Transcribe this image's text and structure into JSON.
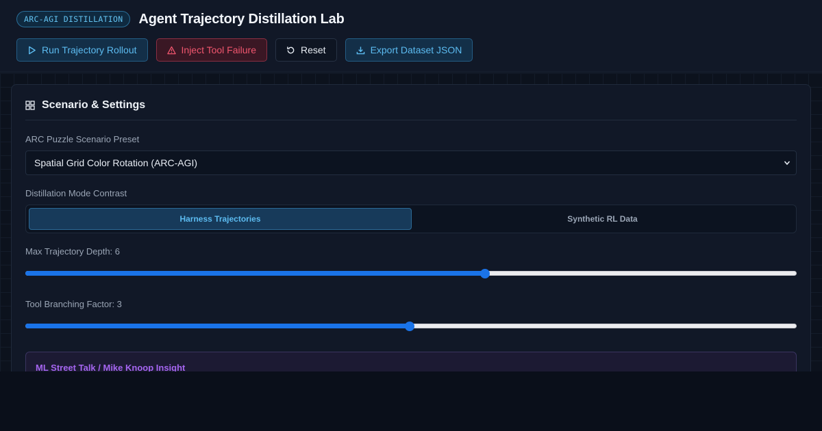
{
  "header": {
    "badge": "ARC-AGI DISTILLATION",
    "title": "Agent Trajectory Distillation Lab"
  },
  "toolbar": {
    "run_label": "Run Trajectory Rollout",
    "inject_label": "Inject Tool Failure",
    "reset_label": "Reset",
    "export_label": "Export Dataset JSON"
  },
  "icons": {
    "run": "play-icon",
    "inject": "warning-triangle-icon",
    "reset": "refresh-icon",
    "export": "download-icon",
    "panel": "grid-icon"
  },
  "colors": {
    "accent_blue": "#5cbbf0",
    "danger": "#f0566e",
    "insight_purple": "#a565f0",
    "slider": "#1a73e8"
  },
  "panel": {
    "title": "Scenario & Settings",
    "scenario": {
      "label": "ARC Puzzle Scenario Preset",
      "selected": "Spatial Grid Color Rotation (ARC-AGI)"
    },
    "mode": {
      "label": "Distillation Mode Contrast",
      "options": [
        "Harness Trajectories",
        "Synthetic RL Data"
      ],
      "selected": "Harness Trajectories"
    },
    "depth": {
      "label": "Max Trajectory Depth: 6",
      "value": 6,
      "fraction": 0.597
    },
    "branching": {
      "label": "Tool Branching Factor: 3",
      "value": 3,
      "fraction": 0.498
    },
    "insight": {
      "title": "ML Street Talk / Mike Knoop Insight"
    }
  }
}
